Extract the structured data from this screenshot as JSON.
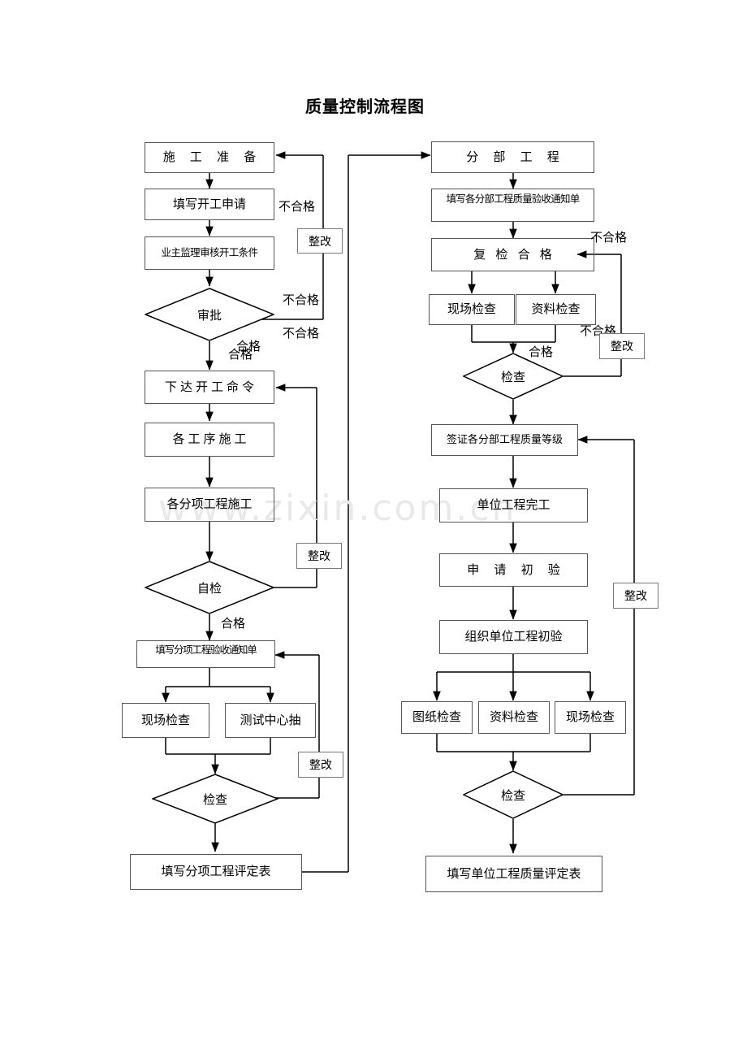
{
  "page": {
    "title": "质量控制流程图",
    "watermark": "www.zixin.com.cn"
  },
  "labels": {
    "fail": "不合格",
    "pass": "合格",
    "amend": "整改"
  },
  "left_column": {
    "nodes": [
      {
        "id": "prep",
        "label": "施 工 准 备"
      },
      {
        "id": "apply",
        "label": "填写开工申请"
      },
      {
        "id": "review",
        "label": "业主监理审核开工条件"
      },
      {
        "id": "approve",
        "label": "审批"
      },
      {
        "id": "order",
        "label": "下达开工命令"
      },
      {
        "id": "process",
        "label": "各工序施工"
      },
      {
        "id": "subitem",
        "label": "各分项工程施工"
      },
      {
        "id": "selfcheck",
        "label": "自检"
      },
      {
        "id": "notice",
        "label": "填写分项工程验收通知单"
      },
      {
        "id": "sitecheck",
        "label": "现场检查"
      },
      {
        "id": "labcheck",
        "label": "测试中心抽"
      },
      {
        "id": "check",
        "label": "检查"
      },
      {
        "id": "evalform",
        "label": "填写分项工程评定表"
      }
    ],
    "edge_labels": [
      {
        "id": "fail-top",
        "text": "不合格"
      },
      {
        "id": "fail-approve-1",
        "text": "不合格"
      },
      {
        "id": "fail-approve-2",
        "text": "不合格"
      },
      {
        "id": "pass-approve-1",
        "text": "合格"
      },
      {
        "id": "pass-approve-2",
        "text": "合格"
      },
      {
        "id": "pass-self",
        "text": "合格"
      }
    ],
    "amend_boxes": [
      {
        "id": "amend-approve",
        "text": "整改"
      },
      {
        "id": "amend-self",
        "text": "整改"
      },
      {
        "id": "amend-check",
        "text": "整改"
      }
    ]
  },
  "right_column": {
    "nodes": [
      {
        "id": "division",
        "label": "分 部 工 程"
      },
      {
        "id": "divnotice",
        "label": "填写各分部工程质量验收通知单"
      },
      {
        "id": "recheck",
        "label": "复    检 合 格"
      },
      {
        "id": "sitecheck2",
        "label": "现场检查"
      },
      {
        "id": "datacheck2",
        "label": "资料检查"
      },
      {
        "id": "check2",
        "label": "检查"
      },
      {
        "id": "signgrade",
        "label": "签证各分部工程质量等级"
      },
      {
        "id": "unitdone",
        "label": "单位工程完工"
      },
      {
        "id": "applyfirst",
        "label": "申 请 初 验"
      },
      {
        "id": "organize",
        "label": "组织单位工程初验"
      },
      {
        "id": "drawcheck",
        "label": "图纸检查"
      },
      {
        "id": "datacheck3",
        "label": "资料检查"
      },
      {
        "id": "sitecheck3",
        "label": "现场检查"
      },
      {
        "id": "check3",
        "label": "检查"
      },
      {
        "id": "unitevalform",
        "label": "填写单位工程质量评定表"
      }
    ],
    "edge_labels": [
      {
        "id": "fail-recheck",
        "text": "不合格"
      },
      {
        "id": "fail-check2",
        "text": "不合格"
      },
      {
        "id": "pass-check2",
        "text": "合格"
      }
    ],
    "amend_boxes": [
      {
        "id": "amend-recheck",
        "text": "整改"
      },
      {
        "id": "amend-unit",
        "text": "整改"
      }
    ]
  },
  "chart_data": {
    "type": "diagram",
    "title": "质量控制流程图",
    "diagram_kind": "flowchart",
    "columns": 2,
    "flow_left": [
      "施 工 准 备",
      "填写开工申请",
      "业主监理审核开工条件",
      "审批 (decision)",
      "下达开工命令",
      "各工序施工",
      "各分项工程施工",
      "自检 (decision)",
      "填写分项工程验收通知单",
      "现场检查 / 测试中心抽",
      "检查 (decision)",
      "填写分项工程评定表"
    ],
    "flow_right": [
      "分 部 工 程",
      "填写各分部工程质量验收通知单",
      "复    检 合 格",
      "现场检查 / 资料检查",
      "检查 (decision)",
      "签证各分部工程质量等级",
      "单位工程完工",
      "申 请 初 验",
      "组织单位工程初验",
      "图纸检查 / 资料检查 / 现场检查",
      "检查 (decision)",
      "填写单位工程质量评定表"
    ]
  }
}
